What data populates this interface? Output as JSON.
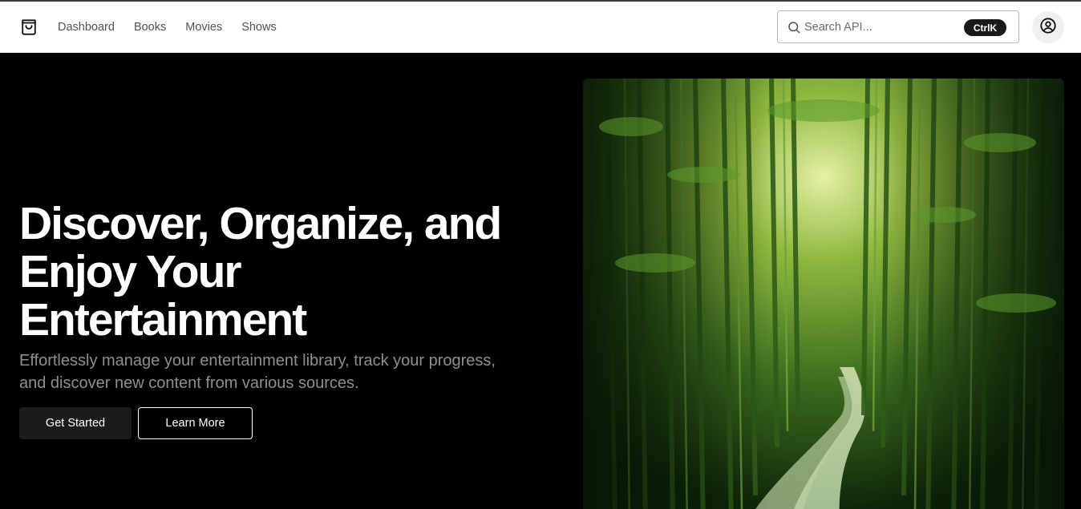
{
  "nav": {
    "logo_icon": "shopping-bag-icon",
    "items": [
      {
        "label": "Dashboard"
      },
      {
        "label": "Books"
      },
      {
        "label": "Movies"
      },
      {
        "label": "Shows"
      }
    ]
  },
  "search": {
    "placeholder": "Search API...",
    "shortcut": "CtrlK",
    "icon": "search-icon"
  },
  "user": {
    "icon": "user-circle-icon"
  },
  "hero": {
    "title_line1": "Discover, Organize, and",
    "title_line2": "Enjoy Your",
    "title_line3": "Entertainment",
    "subtitle": "Effortlessly manage your entertainment library, track your progress, and discover new content from various sources.",
    "primary_button": "Get Started",
    "secondary_button": "Learn More"
  },
  "colors": {
    "header_bg": "#ffffff",
    "hero_bg": "#000000",
    "primary_button_bg": "#1c1c1c",
    "image_green": "#4f8a2a"
  }
}
